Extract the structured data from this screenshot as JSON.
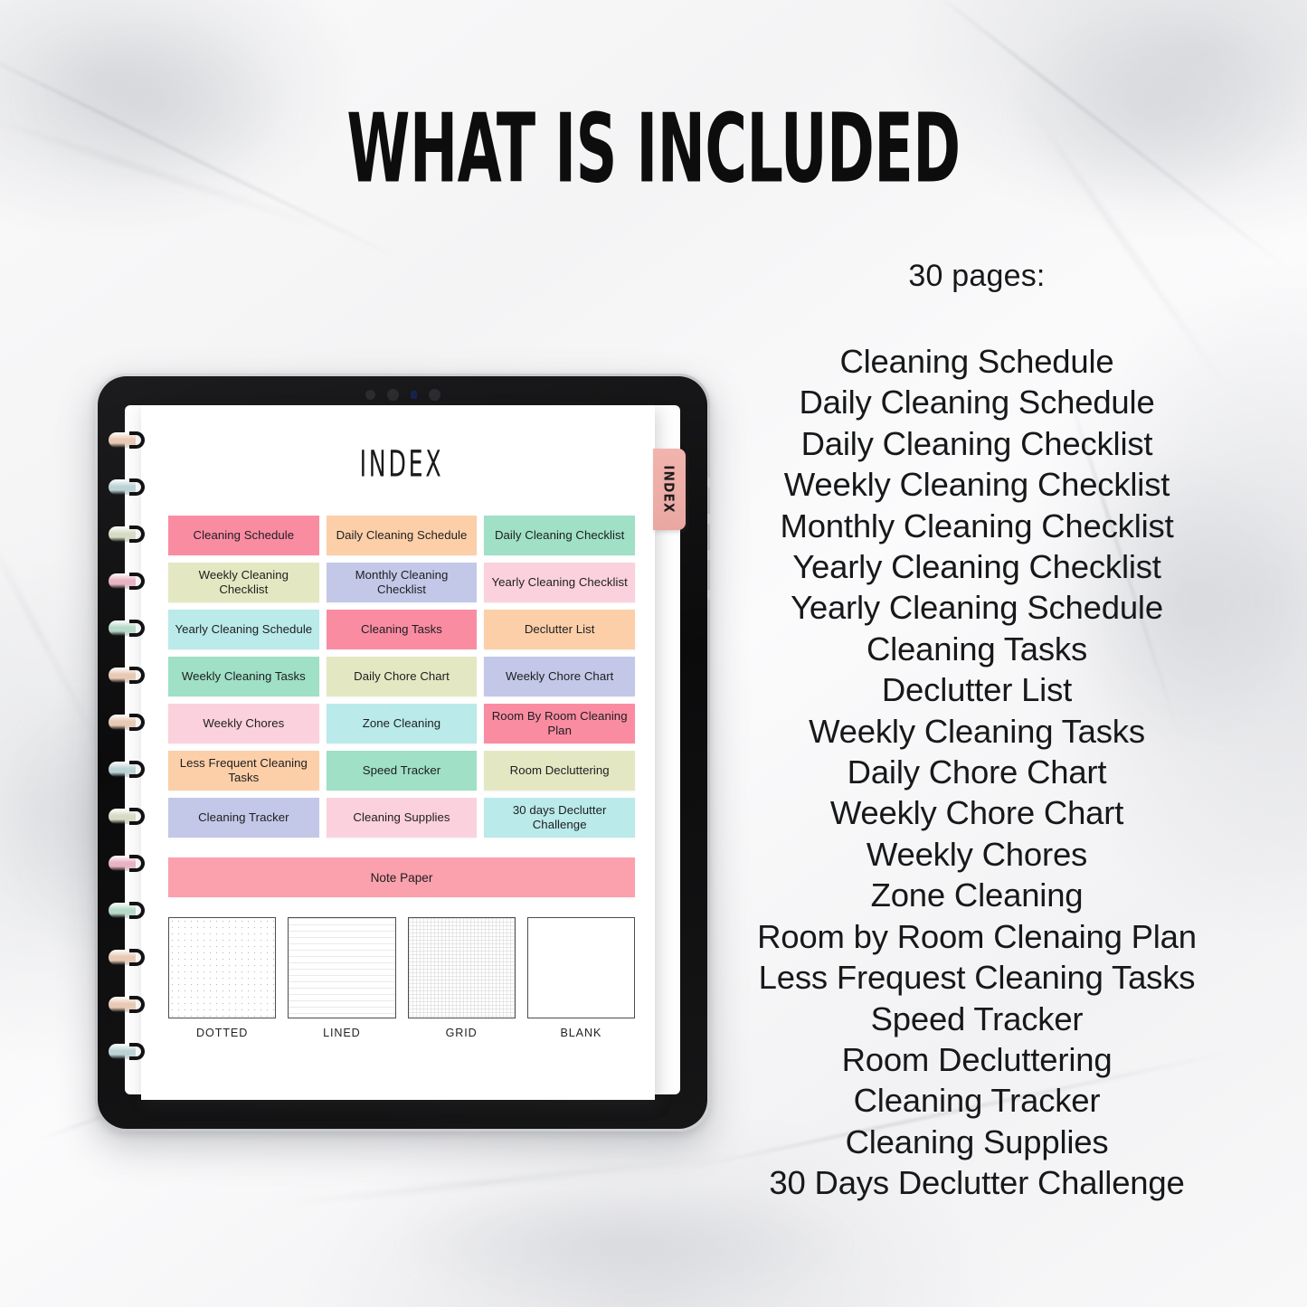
{
  "header": {
    "title": "WHAT IS INCLUDED"
  },
  "included": {
    "pages_count": "30 pages:",
    "items": [
      "Cleaning Schedule",
      "Daily Cleaning Schedule",
      "Daily Cleaning Checklist",
      "Weekly Cleaning Checklist",
      "Monthly Cleaning Checklist",
      "Yearly Cleaning Checklist",
      "Yearly Cleaning Schedule",
      "Cleaning Tasks",
      "Declutter List",
      "Weekly Cleaning Tasks",
      "Daily Chore Chart",
      "Weekly Chore Chart",
      "Weekly Chores",
      "Zone Cleaning",
      "Room by Room Clenaing Plan",
      "Less Frequest Cleaning Tasks",
      "Speed Tracker",
      "Room Decluttering",
      "Cleaning Tracker",
      "Cleaning Supplies",
      "30 Days Declutter Challenge"
    ]
  },
  "tablet": {
    "tab_label": "INDEX",
    "page": {
      "heading": "INDEX",
      "buttons": [
        {
          "label": "Cleaning Schedule",
          "color": "#fa8ca2"
        },
        {
          "label": "Daily Cleaning Schedule",
          "color": "#fccfa8"
        },
        {
          "label": "Daily Cleaning Checklist",
          "color": "#9fe0c7"
        },
        {
          "label": "Weekly Cleaning Checklist",
          "color": "#e4e8c2"
        },
        {
          "label": "Monthly Cleaning Checklist",
          "color": "#c3c8e8"
        },
        {
          "label": "Yearly Cleaning Checklist",
          "color": "#fbd1dd"
        },
        {
          "label": "Yearly Cleaning Schedule",
          "color": "#baeaea"
        },
        {
          "label": "Cleaning Tasks",
          "color": "#fa8ca2"
        },
        {
          "label": "Declutter List",
          "color": "#fccfa8"
        },
        {
          "label": "Weekly Cleaning Tasks",
          "color": "#9fe0c7"
        },
        {
          "label": "Daily Chore Chart",
          "color": "#e4e8c2"
        },
        {
          "label": "Weekly Chore Chart",
          "color": "#c3c8e8"
        },
        {
          "label": "Weekly Chores",
          "color": "#fbd1dd"
        },
        {
          "label": "Zone Cleaning",
          "color": "#baeaea"
        },
        {
          "label": "Room By Room Cleaning Plan",
          "color": "#fa8ca2"
        },
        {
          "label": "Less Frequent Cleaning Tasks",
          "color": "#fccfa8"
        },
        {
          "label": "Speed Tracker",
          "color": "#9fe0c7"
        },
        {
          "label": "Room Decluttering",
          "color": "#e4e8c2"
        },
        {
          "label": "Cleaning Tracker",
          "color": "#c3c8e8"
        },
        {
          "label": "Cleaning Supplies",
          "color": "#fbd1dd"
        },
        {
          "label": "30 days Declutter Challenge",
          "color": "#baeaea"
        }
      ],
      "note_paper": {
        "label": "Note Paper",
        "color": "#fba0ad"
      },
      "samples": [
        {
          "label": "DOTTED",
          "style": "dotted"
        },
        {
          "label": "LINED",
          "style": "lined"
        },
        {
          "label": "GRID",
          "style": "grid"
        },
        {
          "label": "BLANK",
          "style": "blank"
        }
      ],
      "disc_colors": [
        "#e8c9b4",
        "#bcd3d6",
        "#d6dcc4",
        "#e8b3c2",
        "#b6d9c8",
        "#e8c9b4"
      ]
    }
  }
}
